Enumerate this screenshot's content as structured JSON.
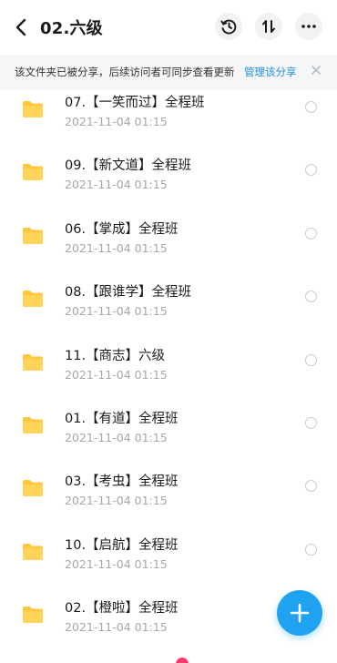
{
  "header": {
    "title": "02.六级",
    "back_icon": "chevron-left-icon",
    "history_icon": "history-icon",
    "sort_icon": "sort-icon",
    "more_icon": "more-horizontal-icon"
  },
  "banner": {
    "text": "该文件夹已被分享，后续访问者可同步查看更新",
    "link": "管理该分享",
    "close_icon": "close-icon"
  },
  "folders": [
    {
      "name": "07.【一笑而过】全程班",
      "date": "2021-11-04  01:15"
    },
    {
      "name": "09.【新文道】全程班",
      "date": "2021-11-04  01:15"
    },
    {
      "name": "06.【掌成】全程班",
      "date": "2021-11-04  01:15"
    },
    {
      "name": "08.【跟谁学】全程班",
      "date": "2021-11-04  01:15"
    },
    {
      "name": "11.【商志】六级",
      "date": "2021-11-04  01:15"
    },
    {
      "name": "01.【有道】全程班",
      "date": "2021-11-04  01:15"
    },
    {
      "name": "03.【考虫】全程班",
      "date": "2021-11-04  01:15"
    },
    {
      "name": "10.【启航】全程班",
      "date": "2021-11-04  01:15"
    },
    {
      "name": "02.【橙啦】全程班",
      "date": "2021-11-04  01:15"
    }
  ],
  "fab": {
    "icon": "plus-icon"
  },
  "colors": {
    "accent": "#1fa2f0",
    "folder": "#ffc83d",
    "link": "#1e90e0"
  }
}
